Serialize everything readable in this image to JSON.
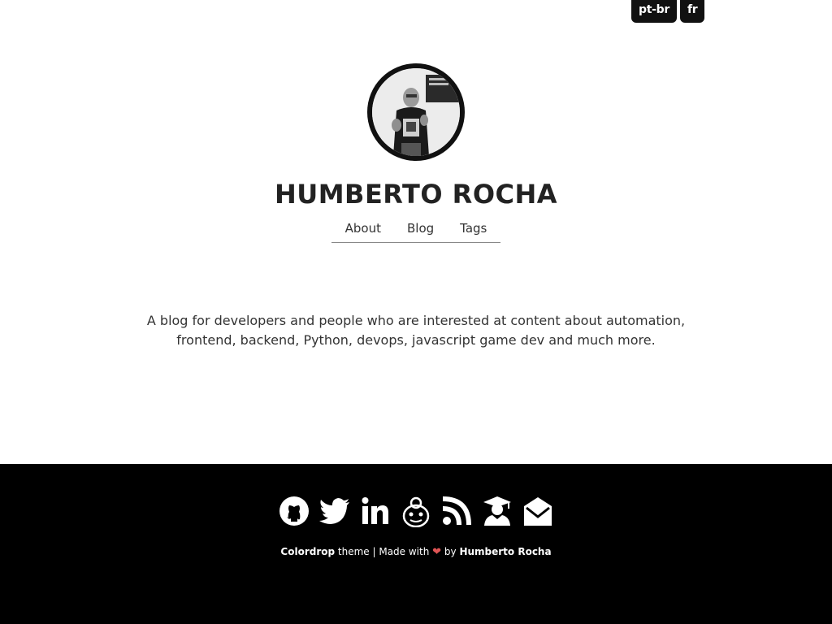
{
  "languages": [
    {
      "label": "pt-br"
    },
    {
      "label": "fr"
    }
  ],
  "site": {
    "title": "HUMBERTO ROCHA",
    "tagline": "A blog for developers and people who are interested at content about automation, frontend, backend, Python, devops, javascript game dev and much more."
  },
  "nav": {
    "items": [
      {
        "label": "About"
      },
      {
        "label": "Blog"
      },
      {
        "label": "Tags"
      }
    ]
  },
  "footer": {
    "social_icons": [
      "github-icon",
      "twitter-icon",
      "linkedin-icon",
      "dev-mascot-icon",
      "rss-icon",
      "graduation-icon",
      "email-icon"
    ],
    "theme_name": "Colordrop",
    "theme_text": "theme | Made with",
    "heart": "❤",
    "by_text": "by",
    "author": "Humberto Rocha"
  },
  "colors": {
    "background": "#ffffff",
    "footer_bg": "#000000",
    "badge_bg": "#111111",
    "heart": "#e05555"
  }
}
